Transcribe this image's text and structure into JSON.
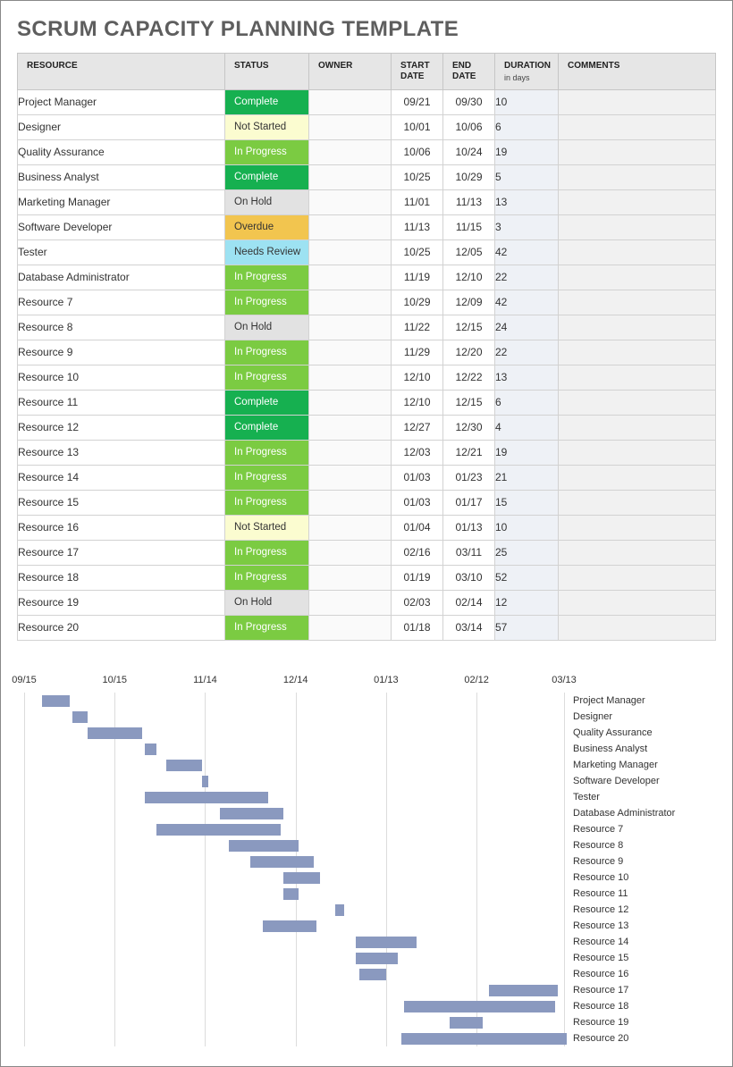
{
  "title": "SCRUM CAPACITY PLANNING TEMPLATE",
  "columns": {
    "resource": "RESOURCE",
    "status": "STATUS",
    "owner": "OWNER",
    "start": "START DATE",
    "end": "END DATE",
    "duration": "DURATION",
    "duration_sub": "in days",
    "comments": "COMMENTS"
  },
  "status_styles": {
    "Complete": "st-complete",
    "Not Started": "st-not-started",
    "In Progress": "st-in-progress",
    "On Hold": "st-on-hold",
    "Overdue": "st-overdue",
    "Needs Review": "st-needs-review"
  },
  "rows": [
    {
      "resource": "Project Manager",
      "status": "Complete",
      "owner": "",
      "start": "09/21",
      "end": "09/30",
      "duration": "10",
      "comments": ""
    },
    {
      "resource": "Designer",
      "status": "Not Started",
      "owner": "",
      "start": "10/01",
      "end": "10/06",
      "duration": "6",
      "comments": ""
    },
    {
      "resource": "Quality Assurance",
      "status": "In Progress",
      "owner": "",
      "start": "10/06",
      "end": "10/24",
      "duration": "19",
      "comments": ""
    },
    {
      "resource": "Business Analyst",
      "status": "Complete",
      "owner": "",
      "start": "10/25",
      "end": "10/29",
      "duration": "5",
      "comments": ""
    },
    {
      "resource": "Marketing Manager",
      "status": "On Hold",
      "owner": "",
      "start": "11/01",
      "end": "11/13",
      "duration": "13",
      "comments": ""
    },
    {
      "resource": "Software Developer",
      "status": "Overdue",
      "owner": "",
      "start": "11/13",
      "end": "11/15",
      "duration": "3",
      "comments": ""
    },
    {
      "resource": "Tester",
      "status": "Needs Review",
      "owner": "",
      "start": "10/25",
      "end": "12/05",
      "duration": "42",
      "comments": ""
    },
    {
      "resource": "Database Administrator",
      "status": "In Progress",
      "owner": "",
      "start": "11/19",
      "end": "12/10",
      "duration": "22",
      "comments": ""
    },
    {
      "resource": "Resource 7",
      "status": "In Progress",
      "owner": "",
      "start": "10/29",
      "end": "12/09",
      "duration": "42",
      "comments": ""
    },
    {
      "resource": "Resource 8",
      "status": "On Hold",
      "owner": "",
      "start": "11/22",
      "end": "12/15",
      "duration": "24",
      "comments": ""
    },
    {
      "resource": "Resource 9",
      "status": "In Progress",
      "owner": "",
      "start": "11/29",
      "end": "12/20",
      "duration": "22",
      "comments": ""
    },
    {
      "resource": "Resource 10",
      "status": "In Progress",
      "owner": "",
      "start": "12/10",
      "end": "12/22",
      "duration": "13",
      "comments": ""
    },
    {
      "resource": "Resource 11",
      "status": "Complete",
      "owner": "",
      "start": "12/10",
      "end": "12/15",
      "duration": "6",
      "comments": ""
    },
    {
      "resource": "Resource 12",
      "status": "Complete",
      "owner": "",
      "start": "12/27",
      "end": "12/30",
      "duration": "4",
      "comments": ""
    },
    {
      "resource": "Resource 13",
      "status": "In Progress",
      "owner": "",
      "start": "12/03",
      "end": "12/21",
      "duration": "19",
      "comments": ""
    },
    {
      "resource": "Resource 14",
      "status": "In Progress",
      "owner": "",
      "start": "01/03",
      "end": "01/23",
      "duration": "21",
      "comments": ""
    },
    {
      "resource": "Resource 15",
      "status": "In Progress",
      "owner": "",
      "start": "01/03",
      "end": "01/17",
      "duration": "15",
      "comments": ""
    },
    {
      "resource": "Resource 16",
      "status": "Not Started",
      "owner": "",
      "start": "01/04",
      "end": "01/13",
      "duration": "10",
      "comments": ""
    },
    {
      "resource": "Resource 17",
      "status": "In Progress",
      "owner": "",
      "start": "02/16",
      "end": "03/11",
      "duration": "25",
      "comments": ""
    },
    {
      "resource": "Resource 18",
      "status": "In Progress",
      "owner": "",
      "start": "01/19",
      "end": "03/10",
      "duration": "52",
      "comments": ""
    },
    {
      "resource": "Resource 19",
      "status": "On Hold",
      "owner": "",
      "start": "02/03",
      "end": "02/14",
      "duration": "12",
      "comments": ""
    },
    {
      "resource": "Resource 20",
      "status": "In Progress",
      "owner": "",
      "start": "01/18",
      "end": "03/14",
      "duration": "57",
      "comments": ""
    }
  ],
  "chart_data": {
    "type": "gantt",
    "axis_ticks": [
      "09/15",
      "10/15",
      "11/14",
      "12/14",
      "01/13",
      "02/12",
      "03/13"
    ],
    "axis_start_serial": 258,
    "axis_end_serial": 437,
    "series": [
      {
        "name": "Project Manager",
        "start": "09/21",
        "end": "09/30"
      },
      {
        "name": "Designer",
        "start": "10/01",
        "end": "10/06"
      },
      {
        "name": "Quality Assurance",
        "start": "10/06",
        "end": "10/24"
      },
      {
        "name": "Business Analyst",
        "start": "10/25",
        "end": "10/29"
      },
      {
        "name": "Marketing Manager",
        "start": "11/01",
        "end": "11/13"
      },
      {
        "name": "Software Developer",
        "start": "11/13",
        "end": "11/15"
      },
      {
        "name": "Tester",
        "start": "10/25",
        "end": "12/05"
      },
      {
        "name": "Database Administrator",
        "start": "11/19",
        "end": "12/10"
      },
      {
        "name": "Resource 7",
        "start": "10/29",
        "end": "12/09"
      },
      {
        "name": "Resource 8",
        "start": "11/22",
        "end": "12/15"
      },
      {
        "name": "Resource 9",
        "start": "11/29",
        "end": "12/20"
      },
      {
        "name": "Resource 10",
        "start": "12/10",
        "end": "12/22"
      },
      {
        "name": "Resource 11",
        "start": "12/10",
        "end": "12/15"
      },
      {
        "name": "Resource 12",
        "start": "12/27",
        "end": "12/30"
      },
      {
        "name": "Resource 13",
        "start": "12/03",
        "end": "12/21"
      },
      {
        "name": "Resource 14",
        "start": "01/03",
        "end": "01/23"
      },
      {
        "name": "Resource 15",
        "start": "01/03",
        "end": "01/17"
      },
      {
        "name": "Resource 16",
        "start": "01/04",
        "end": "01/13"
      },
      {
        "name": "Resource 17",
        "start": "02/16",
        "end": "03/11"
      },
      {
        "name": "Resource 18",
        "start": "01/19",
        "end": "03/10"
      },
      {
        "name": "Resource 19",
        "start": "02/03",
        "end": "02/14"
      },
      {
        "name": "Resource 20",
        "start": "01/18",
        "end": "03/14"
      }
    ]
  }
}
